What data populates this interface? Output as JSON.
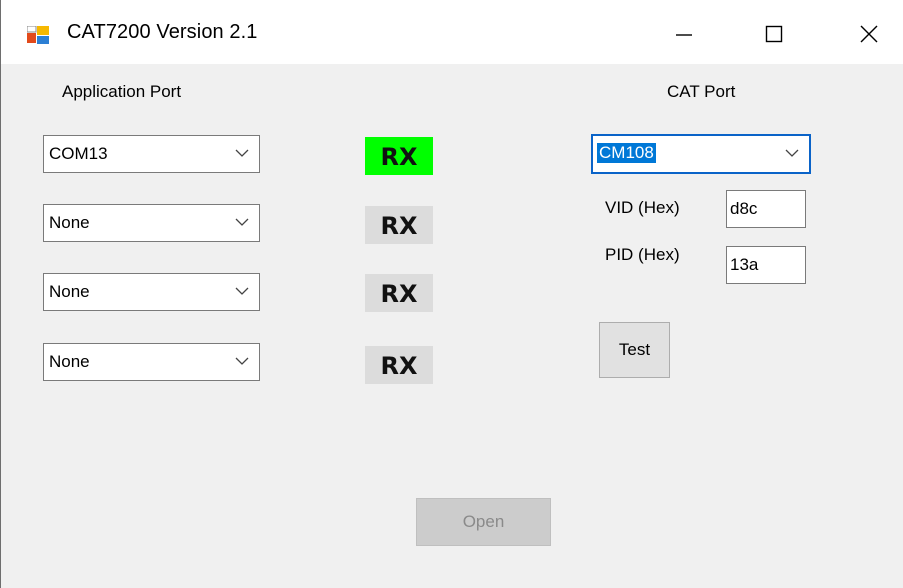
{
  "window": {
    "title": "CAT7200 Version 2.1"
  },
  "titlebar": {
    "icons": [
      "app-icon",
      "minimize-icon",
      "maximize-icon",
      "close-icon"
    ]
  },
  "app_ports": {
    "heading": "Application Port",
    "rows": [
      {
        "port": "COM13",
        "rx": "RX",
        "rx_active": true
      },
      {
        "port": "None",
        "rx": "RX",
        "rx_active": false
      },
      {
        "port": "None",
        "rx": "RX",
        "rx_active": false
      },
      {
        "port": "None",
        "rx": "RX",
        "rx_active": false
      }
    ]
  },
  "cat_port": {
    "heading": "CAT Port",
    "selected": "CM108",
    "vid_label": "VID (Hex)",
    "vid_value": "d8c",
    "pid_label": "PID (Hex)",
    "pid_value": "13a",
    "test_label": "Test"
  },
  "footer": {
    "open_label": "Open",
    "open_enabled": false
  },
  "colors": {
    "rx_active": "#00ff00",
    "rx_inactive": "#dcdcdc",
    "selection": "#0078d7",
    "focus_border": "#0a63c8"
  }
}
